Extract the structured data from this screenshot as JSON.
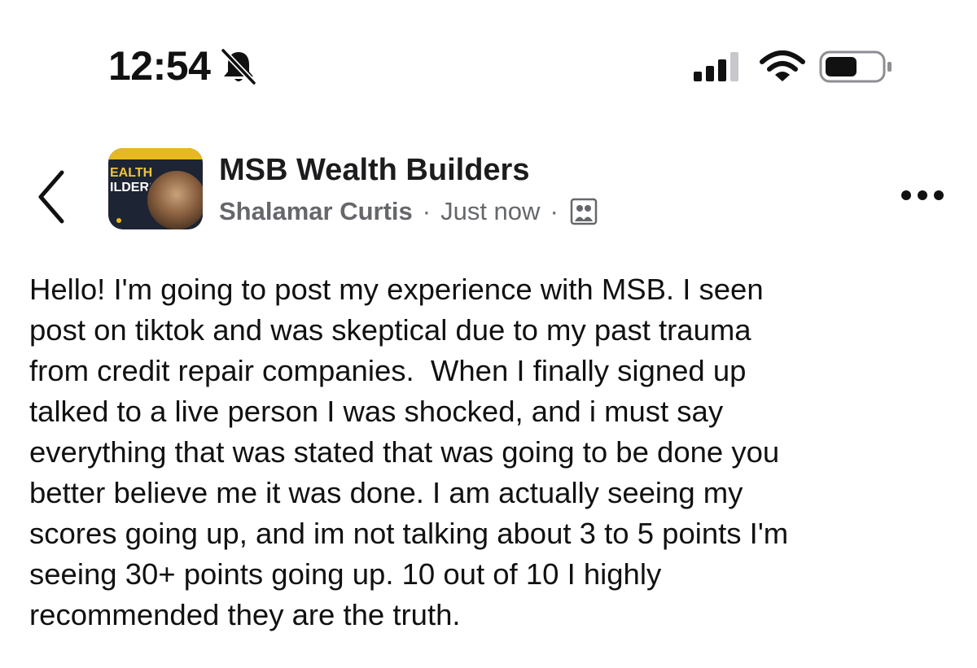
{
  "status_bar": {
    "time": "12:54"
  },
  "header": {
    "page_name": "MSB Wealth Builders",
    "author": "Shalamar Curtis",
    "separator": "·",
    "timestamp": "Just now",
    "avatar_text_line1": "EALTH",
    "avatar_text_line2": "ILDERS"
  },
  "post": {
    "lines": [
      "Hello! I'm going to post my experience with MSB. I seen",
      "post on tiktok and was skeptical due to my past trauma",
      "from credit repair companies.  When I finally signed up",
      "talked to a live person I was shocked, and i must say",
      "everything that was stated that was going to be done you",
      "better believe me it was done. I am actually seeing my",
      "scores going up, and im not talking about 3 to 5 points I'm",
      "seeing 30+ points going up. 10 out of 10 I highly",
      "recommended they are the truth."
    ]
  },
  "icons": {
    "status": [
      "bell-slash-icon",
      "signal-icon",
      "wifi-icon",
      "battery-icon"
    ],
    "header": [
      "back-chevron-icon",
      "group-icon",
      "more-icon"
    ]
  },
  "colors": {
    "text": "#1c1c1e",
    "meta": "#65676b",
    "avatar_bg": "#1d2433",
    "avatar_accent": "#e8b820"
  }
}
